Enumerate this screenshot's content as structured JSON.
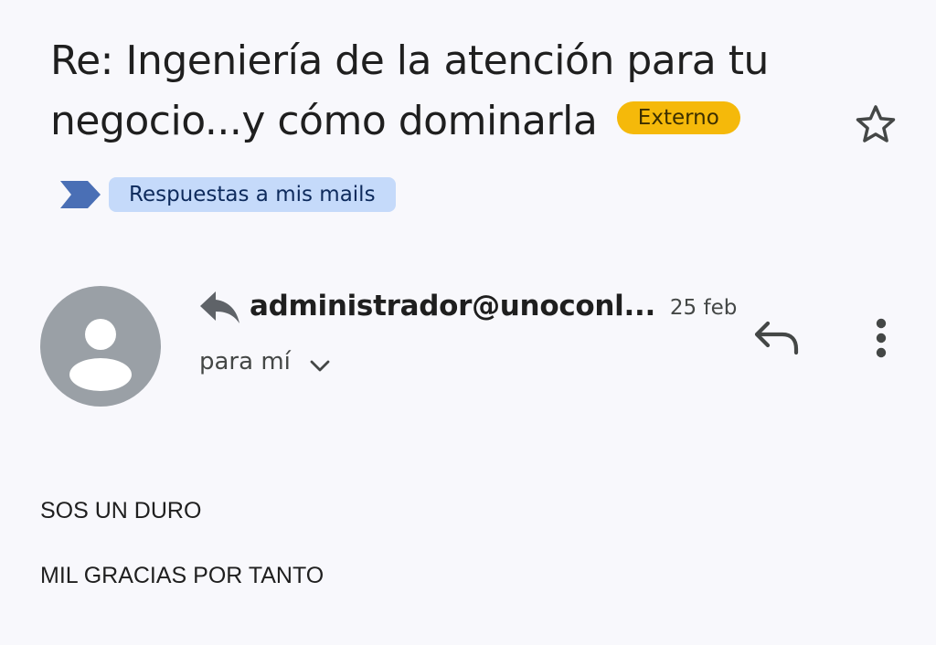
{
  "email": {
    "subject": "Re: Ingeniería de la atención para tu negocio...y cómo dominarla",
    "external_badge": "Externo",
    "label": "Respuestas a mis mails",
    "sender": "administrador@unoconl...",
    "date": "25 feb",
    "recipient": "para mí",
    "body": [
      "SOS UN DURO",
      "MIL GRACIAS POR TANTO"
    ]
  },
  "icons": {
    "star": "star-outline-icon",
    "label_marker": "label-important-icon",
    "replied": "replied-arrow-icon",
    "reply": "reply-icon",
    "more": "more-vert-icon",
    "expand": "chevron-down-icon",
    "avatar": "person-icon"
  },
  "colors": {
    "background": "#f8f8fc",
    "external_badge": "#f5b90a",
    "label_chip": "#c5dafa",
    "label_marker": "#4a6fb5",
    "avatar": "#9aa0a6"
  }
}
